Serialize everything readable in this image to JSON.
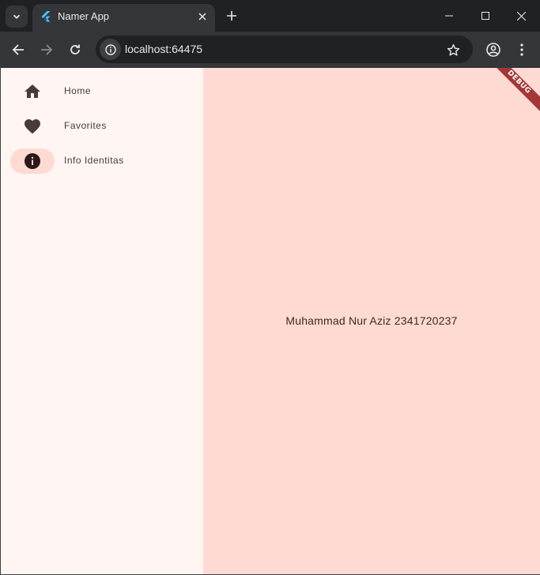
{
  "browser": {
    "tab": {
      "title": "Namer App"
    },
    "address": {
      "url": "localhost:64475"
    }
  },
  "app": {
    "nav": [
      {
        "label": "Home",
        "icon": "home-icon",
        "selected": false
      },
      {
        "label": "Favorites",
        "icon": "favorite-icon",
        "selected": false
      },
      {
        "label": "Info Identitas",
        "icon": "info-icon",
        "selected": true
      }
    ],
    "main_text": "Muhammad Nur Aziz 2341720237",
    "debug_banner": "DEBUG"
  },
  "colors": {
    "rail_bg": "#fff5f3",
    "main_bg": "#ffdad2",
    "indicator": "#ffdad2",
    "icon": "#4a3b37",
    "debug": "#a33636"
  }
}
